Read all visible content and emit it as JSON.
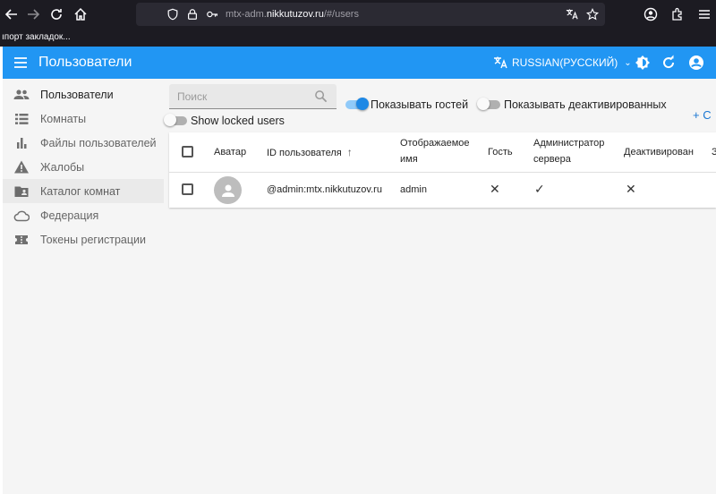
{
  "browser": {
    "url_prefix": "mtx-adm.",
    "url_domain": "nikkutuzov.ru",
    "url_path": "/#/users",
    "bookmarks_text": "ıпорт закладок..."
  },
  "appbar": {
    "title": "Пользователи",
    "language": "RUSSIAN(РУССКИЙ)",
    "color": "#2196f3"
  },
  "sidebar": {
    "items": [
      {
        "label": "Пользователи",
        "icon": "people-icon"
      },
      {
        "label": "Комнаты",
        "icon": "list-icon"
      },
      {
        "label": "Файлы пользователей",
        "icon": "bar-chart-icon"
      },
      {
        "label": "Жалобы",
        "icon": "warning-icon"
      },
      {
        "label": "Каталог комнат",
        "icon": "folder-shared-icon"
      },
      {
        "label": "Федерация",
        "icon": "cloud-icon"
      },
      {
        "label": "Токены регистрации",
        "icon": "ticket-icon"
      }
    ]
  },
  "filters": {
    "search_placeholder": "Поиск",
    "show_guests": "Показывать гостей",
    "show_guests_on": true,
    "show_deactivated": "Показывать деактивированных",
    "show_deactivated_on": false,
    "show_locked": "Show locked users",
    "show_locked_on": false,
    "create_label": "+ С"
  },
  "table": {
    "headers": {
      "avatar": "Аватар",
      "user_id": "ID пользователя",
      "sort_arrow": "↑",
      "displayname_1": "Отображаемое",
      "displayname_2": "имя",
      "guest": "Гость",
      "admin_1": "Администратор",
      "admin_2": "сервера",
      "deactivated": "Деактивирован",
      "extra": "З"
    },
    "rows": [
      {
        "user_id": "@admin:mtx.nikkutuzov.ru",
        "displayname": "admin",
        "guest": "✕",
        "admin": "✓",
        "deactivated": "✕"
      }
    ]
  }
}
